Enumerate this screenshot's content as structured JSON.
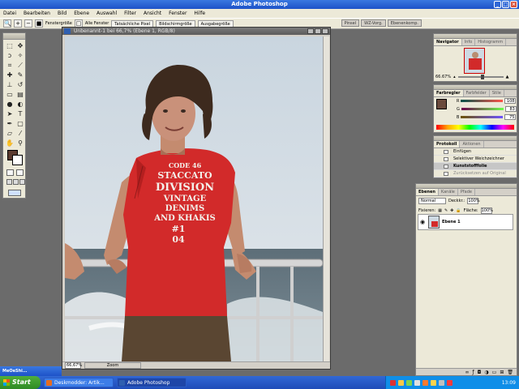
{
  "app": {
    "title": "Adobe Photoshop"
  },
  "menu": [
    "Datei",
    "Bearbeiten",
    "Bild",
    "Ebene",
    "Auswahl",
    "Filter",
    "Ansicht",
    "Fenster",
    "Hilfe"
  ],
  "options": {
    "fenster_groesse": "Fenstergröße",
    "alle_fenster": "Alle Fenster",
    "tatsaechliche_pixel": "Tatsächliche Pixel",
    "bildschirmgroesse": "Bildschirmgröße",
    "ausgabegroesse": "Ausgabegröße"
  },
  "palette_well": [
    "Pinsel",
    "WZ-Vorg.",
    "Ebenenkomp."
  ],
  "document": {
    "title": "Unbenannt-1 bei 66,7% (Ebene 1, RGB/8)",
    "zoom": "66,67%",
    "zoom_label": "Zoom",
    "shirt_lines": [
      "CODE 46",
      "STACCATO",
      "DIVISION",
      "VINTAGE",
      "DENIMS",
      "AND KHAKIS",
      "#1",
      "04"
    ]
  },
  "navigator": {
    "tabs": [
      "Navigator",
      "Info",
      "Histogramm"
    ],
    "zoom": "66.67%",
    "zoom_fraction": 0.55
  },
  "color": {
    "tabs": [
      "Farbregler",
      "Farbfelder",
      "Stile"
    ],
    "r_label": "R",
    "r": "108",
    "g_label": "G",
    "g": "83",
    "b_label": "B",
    "b": "75"
  },
  "history": {
    "tabs": [
      "Protokoll",
      "Aktionen"
    ],
    "items": [
      {
        "label": "Einfügen",
        "state": "normal"
      },
      {
        "label": "Selektiver Weichzeichner",
        "state": "normal"
      },
      {
        "label": "Kunststofffolie",
        "state": "active"
      },
      {
        "label": "Zurücksetzen auf Original",
        "state": "dim"
      }
    ]
  },
  "layers": {
    "tabs": [
      "Ebenen",
      "Kanäle",
      "Pfade"
    ],
    "blend_mode": "Normal",
    "opacity_label": "Deckkr.:",
    "opacity": "100%",
    "lock_label": "Fixieren:",
    "fill_label": "Fläche:",
    "fill": "100%",
    "layer_name": "Ebene 1"
  },
  "minimized_window": "MeOeShi...",
  "taskbar": {
    "start": "Start",
    "items": [
      {
        "label": "Deskmodder: Artik..."
      },
      {
        "label": "Adobe Photoshop"
      }
    ],
    "clock": "13:09"
  },
  "colors": {
    "accent_titlebar": "#1d52c8",
    "shirt_red": "#d22a2a",
    "foreground_color": "#5a3a2e"
  }
}
